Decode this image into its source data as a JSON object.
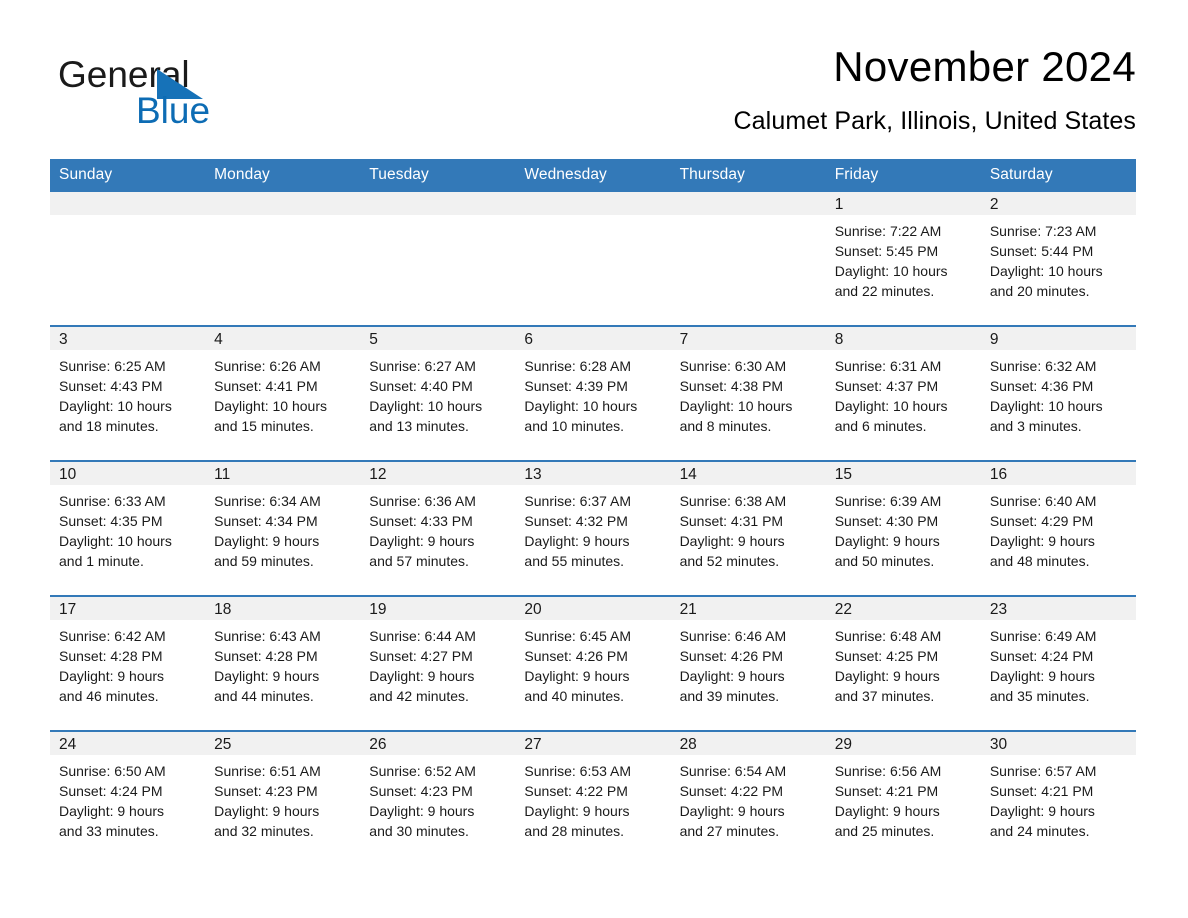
{
  "logo": {
    "text_primary": "General",
    "text_secondary": "Blue",
    "primary_color": "#1a1a1a",
    "accent_color": "#1672b8"
  },
  "header": {
    "title": "November 2024",
    "location": "Calumet Park, Illinois, United States"
  },
  "calendar": {
    "header_bg": "#3379b8",
    "daynum_bg": "#f1f1f1",
    "weekdays": [
      "Sunday",
      "Monday",
      "Tuesday",
      "Wednesday",
      "Thursday",
      "Friday",
      "Saturday"
    ],
    "weeks": [
      [
        {
          "day": "",
          "lines": []
        },
        {
          "day": "",
          "lines": []
        },
        {
          "day": "",
          "lines": []
        },
        {
          "day": "",
          "lines": []
        },
        {
          "day": "",
          "lines": []
        },
        {
          "day": "1",
          "lines": [
            "Sunrise: 7:22 AM",
            "Sunset: 5:45 PM",
            "Daylight: 10 hours",
            "and 22 minutes."
          ]
        },
        {
          "day": "2",
          "lines": [
            "Sunrise: 7:23 AM",
            "Sunset: 5:44 PM",
            "Daylight: 10 hours",
            "and 20 minutes."
          ]
        }
      ],
      [
        {
          "day": "3",
          "lines": [
            "Sunrise: 6:25 AM",
            "Sunset: 4:43 PM",
            "Daylight: 10 hours",
            "and 18 minutes."
          ]
        },
        {
          "day": "4",
          "lines": [
            "Sunrise: 6:26 AM",
            "Sunset: 4:41 PM",
            "Daylight: 10 hours",
            "and 15 minutes."
          ]
        },
        {
          "day": "5",
          "lines": [
            "Sunrise: 6:27 AM",
            "Sunset: 4:40 PM",
            "Daylight: 10 hours",
            "and 13 minutes."
          ]
        },
        {
          "day": "6",
          "lines": [
            "Sunrise: 6:28 AM",
            "Sunset: 4:39 PM",
            "Daylight: 10 hours",
            "and 10 minutes."
          ]
        },
        {
          "day": "7",
          "lines": [
            "Sunrise: 6:30 AM",
            "Sunset: 4:38 PM",
            "Daylight: 10 hours",
            "and 8 minutes."
          ]
        },
        {
          "day": "8",
          "lines": [
            "Sunrise: 6:31 AM",
            "Sunset: 4:37 PM",
            "Daylight: 10 hours",
            "and 6 minutes."
          ]
        },
        {
          "day": "9",
          "lines": [
            "Sunrise: 6:32 AM",
            "Sunset: 4:36 PM",
            "Daylight: 10 hours",
            "and 3 minutes."
          ]
        }
      ],
      [
        {
          "day": "10",
          "lines": [
            "Sunrise: 6:33 AM",
            "Sunset: 4:35 PM",
            "Daylight: 10 hours",
            "and 1 minute."
          ]
        },
        {
          "day": "11",
          "lines": [
            "Sunrise: 6:34 AM",
            "Sunset: 4:34 PM",
            "Daylight: 9 hours",
            "and 59 minutes."
          ]
        },
        {
          "day": "12",
          "lines": [
            "Sunrise: 6:36 AM",
            "Sunset: 4:33 PM",
            "Daylight: 9 hours",
            "and 57 minutes."
          ]
        },
        {
          "day": "13",
          "lines": [
            "Sunrise: 6:37 AM",
            "Sunset: 4:32 PM",
            "Daylight: 9 hours",
            "and 55 minutes."
          ]
        },
        {
          "day": "14",
          "lines": [
            "Sunrise: 6:38 AM",
            "Sunset: 4:31 PM",
            "Daylight: 9 hours",
            "and 52 minutes."
          ]
        },
        {
          "day": "15",
          "lines": [
            "Sunrise: 6:39 AM",
            "Sunset: 4:30 PM",
            "Daylight: 9 hours",
            "and 50 minutes."
          ]
        },
        {
          "day": "16",
          "lines": [
            "Sunrise: 6:40 AM",
            "Sunset: 4:29 PM",
            "Daylight: 9 hours",
            "and 48 minutes."
          ]
        }
      ],
      [
        {
          "day": "17",
          "lines": [
            "Sunrise: 6:42 AM",
            "Sunset: 4:28 PM",
            "Daylight: 9 hours",
            "and 46 minutes."
          ]
        },
        {
          "day": "18",
          "lines": [
            "Sunrise: 6:43 AM",
            "Sunset: 4:28 PM",
            "Daylight: 9 hours",
            "and 44 minutes."
          ]
        },
        {
          "day": "19",
          "lines": [
            "Sunrise: 6:44 AM",
            "Sunset: 4:27 PM",
            "Daylight: 9 hours",
            "and 42 minutes."
          ]
        },
        {
          "day": "20",
          "lines": [
            "Sunrise: 6:45 AM",
            "Sunset: 4:26 PM",
            "Daylight: 9 hours",
            "and 40 minutes."
          ]
        },
        {
          "day": "21",
          "lines": [
            "Sunrise: 6:46 AM",
            "Sunset: 4:26 PM",
            "Daylight: 9 hours",
            "and 39 minutes."
          ]
        },
        {
          "day": "22",
          "lines": [
            "Sunrise: 6:48 AM",
            "Sunset: 4:25 PM",
            "Daylight: 9 hours",
            "and 37 minutes."
          ]
        },
        {
          "day": "23",
          "lines": [
            "Sunrise: 6:49 AM",
            "Sunset: 4:24 PM",
            "Daylight: 9 hours",
            "and 35 minutes."
          ]
        }
      ],
      [
        {
          "day": "24",
          "lines": [
            "Sunrise: 6:50 AM",
            "Sunset: 4:24 PM",
            "Daylight: 9 hours",
            "and 33 minutes."
          ]
        },
        {
          "day": "25",
          "lines": [
            "Sunrise: 6:51 AM",
            "Sunset: 4:23 PM",
            "Daylight: 9 hours",
            "and 32 minutes."
          ]
        },
        {
          "day": "26",
          "lines": [
            "Sunrise: 6:52 AM",
            "Sunset: 4:23 PM",
            "Daylight: 9 hours",
            "and 30 minutes."
          ]
        },
        {
          "day": "27",
          "lines": [
            "Sunrise: 6:53 AM",
            "Sunset: 4:22 PM",
            "Daylight: 9 hours",
            "and 28 minutes."
          ]
        },
        {
          "day": "28",
          "lines": [
            "Sunrise: 6:54 AM",
            "Sunset: 4:22 PM",
            "Daylight: 9 hours",
            "and 27 minutes."
          ]
        },
        {
          "day": "29",
          "lines": [
            "Sunrise: 6:56 AM",
            "Sunset: 4:21 PM",
            "Daylight: 9 hours",
            "and 25 minutes."
          ]
        },
        {
          "day": "30",
          "lines": [
            "Sunrise: 6:57 AM",
            "Sunset: 4:21 PM",
            "Daylight: 9 hours",
            "and 24 minutes."
          ]
        }
      ]
    ]
  }
}
